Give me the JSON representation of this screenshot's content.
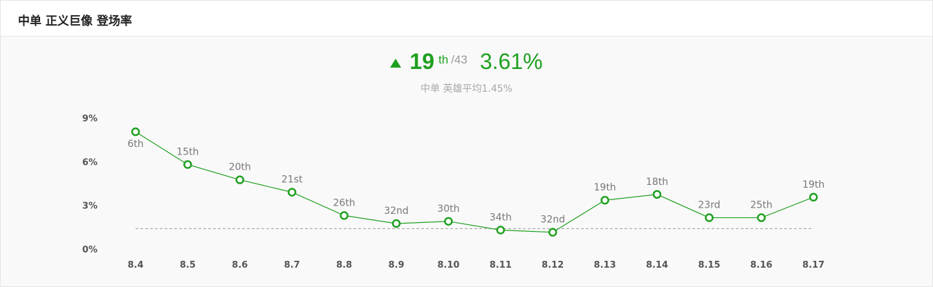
{
  "header": {
    "title": "中单 正义巨像 登场率"
  },
  "summary": {
    "rank": "19",
    "rank_suffix": "th",
    "rank_total": "/43",
    "rate": "3.61%",
    "role": "中单",
    "avg_label": "英雄平均1.45%"
  },
  "colors": {
    "accent": "#1fa01f",
    "avg_line": "#999999"
  },
  "icons": {
    "trend": "triangle-up-icon"
  },
  "chart_data": {
    "type": "line",
    "categories": [
      "8.4",
      "8.5",
      "8.6",
      "8.7",
      "8.8",
      "8.9",
      "8.10",
      "8.11",
      "8.12",
      "8.13",
      "8.14",
      "8.15",
      "8.16",
      "8.17"
    ],
    "values": [
      8.1,
      5.85,
      4.8,
      3.95,
      2.35,
      1.8,
      1.95,
      1.35,
      1.2,
      3.4,
      3.8,
      2.2,
      2.2,
      3.61
    ],
    "point_labels": [
      "6th",
      "15th",
      "20th",
      "21st",
      "26th",
      "32nd",
      "30th",
      "34th",
      "32nd",
      "19th",
      "18th",
      "23rd",
      "25th",
      "19th"
    ],
    "yticks": [
      "0%",
      "3%",
      "6%",
      "9%"
    ],
    "ytick_values": [
      0,
      3,
      6,
      9
    ],
    "ylim": [
      0,
      9
    ],
    "average": 1.45,
    "grid": false
  }
}
